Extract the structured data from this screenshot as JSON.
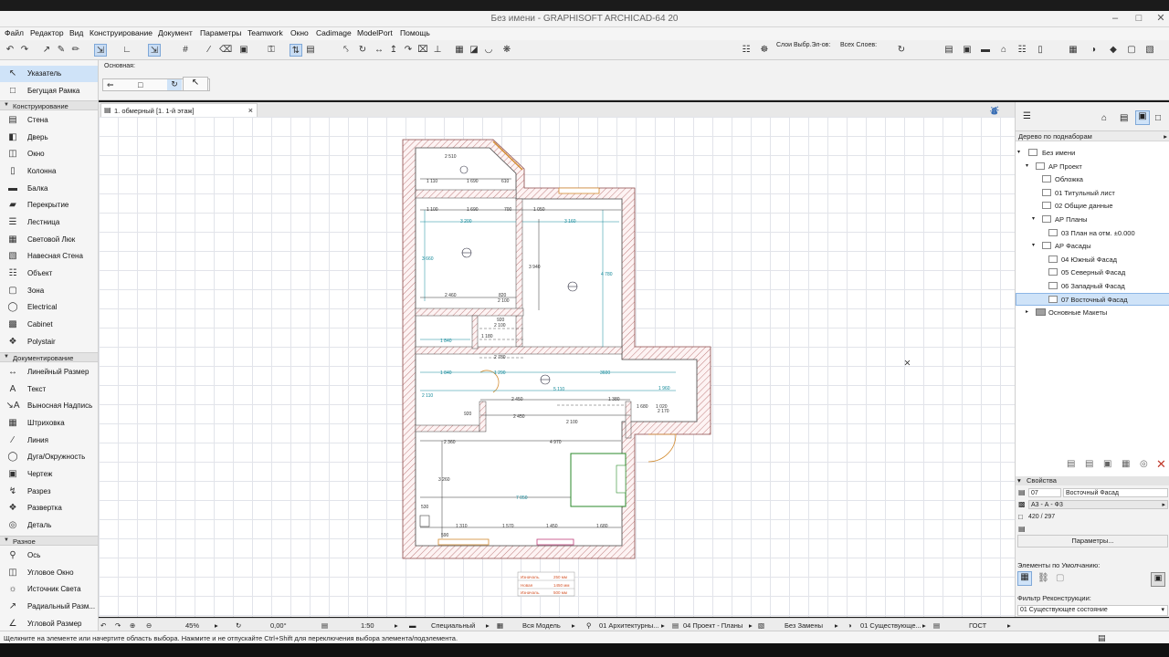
{
  "window": {
    "title": "Без имени - GRAPHISOFT ARCHICAD-64 20"
  },
  "menu": [
    "Файл",
    "Редактор",
    "Вид",
    "Конструирование",
    "Документ",
    "Параметры",
    "Teamwork",
    "Окно",
    "Cadimage",
    "ModelPort",
    "Помощь"
  ],
  "toolbar": {
    "layers_label": "Слои Выбр.Эл-ов:",
    "all_layers_label": "Всех Слоев:"
  },
  "infobox": {
    "label": "Основная:"
  },
  "toolbox": {
    "top": [
      {
        "label": "Указатель",
        "icon": "arrow-icon"
      },
      {
        "label": "Бегущая Рамка",
        "icon": "marquee-icon"
      }
    ],
    "sections": [
      {
        "title": "Конструирование",
        "items": [
          "Стена",
          "Дверь",
          "Окно",
          "Колонна",
          "Балка",
          "Перекрытие",
          "Лестница",
          "Световой Люк",
          "Навесная Стена",
          "Объект",
          "Зона",
          "Electrical",
          "Cabinet",
          "Polystair"
        ]
      },
      {
        "title": "Документирование",
        "items": [
          "Линейный Размер",
          "Текст",
          "Выносная Надпись",
          "Штриховка",
          "Линия",
          "Дуга/Окружность",
          "Чертеж",
          "Разрез",
          "Развертка",
          "Деталь"
        ]
      },
      {
        "title": "Разное",
        "items": [
          "Ось",
          "Угловое Окно",
          "Источник Света",
          "Радиальный Разм...",
          "Угловой Размер"
        ]
      }
    ]
  },
  "tab": {
    "label": "1. обмерный [1. 1-й этаж]"
  },
  "plan": {
    "dims": [
      "2 510",
      "1 110",
      "1 690",
      "610",
      "1 100",
      "1 690",
      "700",
      "1 050",
      "3 200",
      "3 160",
      "3 660",
      "2 460",
      "820",
      "2 100",
      "3 940",
      "4 780",
      "920",
      "2 100",
      "1 840",
      "1 180",
      "1 840",
      "1 290",
      "3600",
      "5 110",
      "1 960",
      "2 110",
      "2 450",
      "1 380",
      "1 680",
      "1 020",
      "2 170",
      "920",
      "2 450",
      "2 100",
      "2 360",
      "4 970",
      "3 260",
      "7 050",
      "530",
      "1 310",
      "1 570",
      "1 450",
      "1 680",
      "2 780",
      "590"
    ],
    "legend": [
      {
        "label": "Изначаль.",
        "value": "250 мм"
      },
      {
        "label": "Новая",
        "value": "1450 мм"
      },
      {
        "label": "Изначаль.",
        "value": "500 мм"
      }
    ]
  },
  "navigator": {
    "selector": "Дерево по поднаборам",
    "root": "Без имени",
    "items": [
      {
        "label": "АР Проект",
        "level": 1,
        "type": "folder"
      },
      {
        "label": "Обложка",
        "level": 2,
        "type": "sheet"
      },
      {
        "label": "01 Титульный лист",
        "level": 2,
        "type": "sheet"
      },
      {
        "label": "02 Общие данные",
        "level": 2,
        "type": "sheet"
      },
      {
        "label": "АР Планы",
        "level": 2,
        "type": "folder"
      },
      {
        "label": "03 План на отм. ±0.000",
        "level": 3,
        "type": "sheet"
      },
      {
        "label": "АР Фасады",
        "level": 2,
        "type": "folder"
      },
      {
        "label": "04 Южный Фасад",
        "level": 3,
        "type": "sheet"
      },
      {
        "label": "05 Северный Фасад",
        "level": 3,
        "type": "sheet"
      },
      {
        "label": "06 Западный Фасад",
        "level": 3,
        "type": "sheet"
      },
      {
        "label": "07 Восточный Фасад",
        "level": 3,
        "type": "sheet",
        "selected": true
      },
      {
        "label": "Основные Макеты",
        "level": 1,
        "type": "folder"
      }
    ]
  },
  "properties": {
    "title": "Свойства",
    "id": "07",
    "name": "Восточный Фасад",
    "format": "А3 - А - Ф3",
    "size": "420 / 297",
    "params_button": "Параметры...",
    "defaults_title": "Элементы по Умолчанию:",
    "filter_title": "Фильтр Реконструкции:",
    "filter_value": "01 Существующее состояние"
  },
  "status": {
    "zoom": "45%",
    "angle": "0,00°",
    "scale": "1:50",
    "structure": "Специальный",
    "model": "Вся Модель",
    "layers": "01 Архитектурны...",
    "penset": "04 Проект - Планы",
    "override": "Без Замены",
    "renovation": "01 Существующе...",
    "dim_standard": "ГОСТ"
  },
  "hint": "Щелкните на элементе или начертите область выбора. Нажмите и не отпускайте Ctrl+Shift для переключения выбора элемента/подэлемента."
}
